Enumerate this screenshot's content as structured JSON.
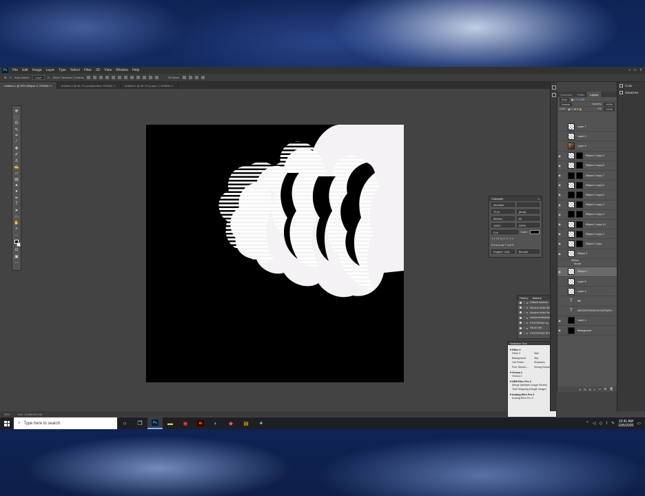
{
  "menus": [
    "File",
    "Edit",
    "Image",
    "Layer",
    "Type",
    "Select",
    "Filter",
    "3D",
    "View",
    "Window",
    "Help"
  ],
  "options": {
    "auto_select": "Auto-Select:",
    "auto_select_target": "Layer",
    "transform_controls": "Show Transform Controls",
    "mode_3d": "3D Mode:"
  },
  "doc_tabs": [
    {
      "label": "Untitled-1 @ 50% (Ellipse 2, RGB/8) *",
      "active": true
    },
    {
      "label": "Untitled-2 @ 66.7% (sculptedfine, RGB/8) *",
      "active": false
    },
    {
      "label": "Untitled-3 @ 66.7% (Layer 1, RGB/8) *",
      "active": false
    }
  ],
  "status": {
    "zoom": "50%",
    "doc": "Doc: 13.8M/102.4M"
  },
  "character": {
    "title": "Character",
    "font": "Mondale",
    "size": "72 pt",
    "leading": "(Auto)",
    "kerning": "Metrics",
    "tracking": "50",
    "vscale": "100%",
    "hscale": "100%",
    "baseline": "0 pt",
    "color_label": "Color:",
    "style_buttons": "T T TT Tr T' T, T T",
    "opentype_buttons": "fi ∂ st A ad T 1st ½",
    "language": "English: USA",
    "aa": "Smooth"
  },
  "history_panel": {
    "tabs": [
      "History",
      "Actions"
    ],
    "actions": [
      "Default Actions",
      "Modern Artist Set",
      "Modern Artist Set",
      "webfont/artisthub",
      "POSTERIZE by",
      "READ ME",
      "POSTERIZE EFFE"
    ]
  },
  "selective_tool": {
    "title": "Selective Tool",
    "sections": [
      {
        "name": "Dfine 2",
        "items": [
          "Dfine 2",
          "Skin",
          "Background",
          "Sky",
          "Hot Pixels",
          "Shadows",
          "Fine Structu...",
          "Strong Noises"
        ]
      },
      {
        "name": "Viveza 2",
        "items": [
          "Viveza 2"
        ]
      },
      {
        "name": "HDR Efex Pro 2",
        "items": [
          "Merge (Multiple Image Series)",
          "Tone Mapping (Single Image)"
        ]
      },
      {
        "name": "Analog Efex Pro 2",
        "items": [
          "Analog Efex Pro 2"
        ]
      }
    ]
  },
  "right_strip": [
    "Color",
    "Swatches"
  ],
  "layers_panel": {
    "tabs": [
      "Channels",
      "Paths",
      "Layers"
    ],
    "kind": "Kind",
    "blend": "Normal",
    "opacity_label": "Opacity:",
    "opacity": "100%",
    "lock_label": "Lock:",
    "fill_label": "Fill:",
    "fill": "100%",
    "layers": [
      {
        "name": "Layer 7",
        "eye": false,
        "thumb": "checker",
        "mask": false,
        "selected": false
      },
      {
        "name": "Layer 2",
        "eye": false,
        "thumb": "checker",
        "mask": false,
        "selected": false
      },
      {
        "name": "Layer 6",
        "eye": false,
        "thumb": "img",
        "mask": false,
        "selected": false
      },
      {
        "name": "Ellipse 2 copy 9",
        "eye": true,
        "thumb": "checker",
        "mask": true,
        "selected": false
      },
      {
        "name": "Ellipse 2 copy 8",
        "eye": true,
        "thumb": "checker",
        "mask": true,
        "selected": false
      },
      {
        "name": "Ellipse 2 copy 7",
        "eye": true,
        "thumb": "black",
        "mask": true,
        "selected": false
      },
      {
        "name": "Ellipse 2 copy 6",
        "eye": true,
        "thumb": "checker",
        "mask": true,
        "selected": false
      },
      {
        "name": "Ellipse 2 copy 5",
        "eye": true,
        "thumb": "black",
        "mask": true,
        "selected": false
      },
      {
        "name": "Ellipse 2 copy 3",
        "eye": true,
        "thumb": "checker",
        "mask": true,
        "selected": false
      },
      {
        "name": "Ellipse 2 copy 4",
        "eye": true,
        "thumb": "black",
        "mask": true,
        "selected": false
      },
      {
        "name": "Ellipse 2 copy 10",
        "eye": true,
        "thumb": "checker",
        "mask": true,
        "selected": false
      },
      {
        "name": "Ellipse 2 copy 2",
        "eye": true,
        "thumb": "checker",
        "mask": true,
        "selected": false
      },
      {
        "name": "Ellipse 2 copy",
        "eye": true,
        "thumb": "checker",
        "mask": true,
        "selected": false
      },
      {
        "name": "Ellipse 3",
        "eye": true,
        "thumb": "checker",
        "mask": false,
        "selected": false
      },
      {
        "name": "Ellipse 2",
        "eye": true,
        "thumb": "checker",
        "mask": false,
        "selected": true
      },
      {
        "name": "Layer 5",
        "eye": false,
        "thumb": "checker",
        "mask": false,
        "selected": false
      },
      {
        "name": "Layer 4",
        "eye": false,
        "thumb": "checker",
        "mask": false,
        "selected": false
      },
      {
        "name": "ttttt",
        "eye": false,
        "thumb": "type",
        "mask": false,
        "selected": false
      },
      {
        "name": "ABCDEFGHIJKLM NOPQRS...",
        "eye": false,
        "thumb": "type",
        "mask": false,
        "selected": false
      },
      {
        "name": "Layer 1",
        "eye": true,
        "thumb": "black",
        "mask": false,
        "selected": false
      },
      {
        "name": "Background",
        "eye": true,
        "thumb": "black",
        "mask": false,
        "selected": false
      }
    ],
    "effects_label": "Effects",
    "stroke_label": "Stroke"
  },
  "taskbar": {
    "search_placeholder": "Type here to search",
    "time": "12:41 AM",
    "date": "10/5/2020"
  }
}
